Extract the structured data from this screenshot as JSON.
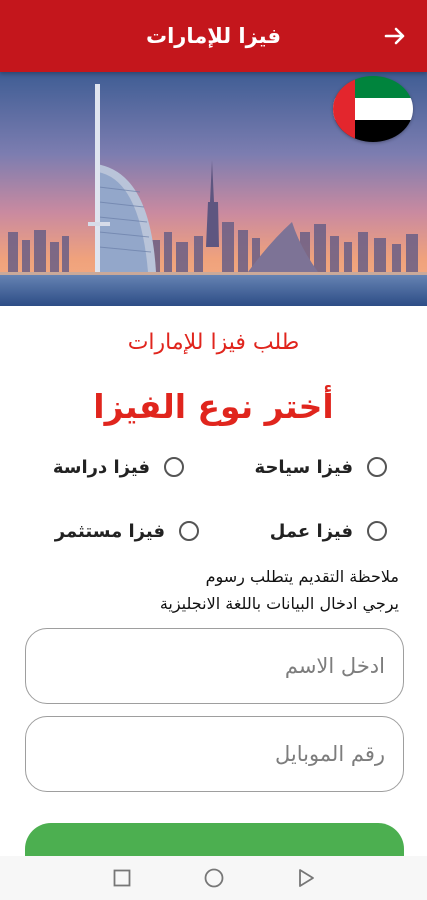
{
  "appbar": {
    "title": "فيزا للإمارات",
    "back_icon": "arrow-right-icon",
    "color": "#c4161c"
  },
  "hero": {
    "image": "dubai-skyline-burj-al-arab",
    "flag": "uae-flag-icon"
  },
  "form": {
    "subtitle": "طلب فيزا للإمارات",
    "heading": "أختر نوع الفيزا",
    "accent_color": "#e0251d",
    "visa_options": [
      {
        "label": "فيزا سياحة",
        "selected": false
      },
      {
        "label": "فيزا دراسة",
        "selected": false
      },
      {
        "label": "فيزا عمل",
        "selected": false
      },
      {
        "label": "فيزا مستثمر",
        "selected": false
      }
    ],
    "note_line1": "ملاحظة التقديم يتطلب رسوم",
    "note_line2": "يرجي ادخال البيانات باللغة الانجليزية",
    "name_placeholder": "ادخل الاسم",
    "name_value": "",
    "mobile_placeholder": "رقم الموبايل",
    "mobile_value": "",
    "submit_color": "#4caf50"
  },
  "system_nav": {
    "recents_icon": "square-icon",
    "home_icon": "circle-icon",
    "back_icon": "triangle-back-icon"
  }
}
